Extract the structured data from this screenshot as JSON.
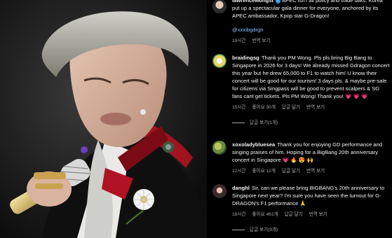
{
  "comments": [
    {
      "username": "lawrencewongst",
      "verified": true,
      "text": "APEC isn't all policy and trade talks. Korea put up a spectacular gala dinner for everyone, anchored by its APEC ambassador, Kpop star G-Dragon!",
      "mention": "@xxxibgdrgn",
      "time": "19시간",
      "translate": "번역 보기"
    },
    {
      "username": "braidingsg",
      "text": "Thank you PM Wong. Pls pls bring Big Bang to Singapore in 2026 for 3 days! We already missed Gdragon concert this year but he drew 65,000 to F1 to watch him! U know their concert will be good for our tourism! 3 days pls. & maybe pre-sale for citizens via Singpass will be good to prevent scalpers & SG fans cant get tickets. Pls PM Wong! Thank you!",
      "emojis": "💗 💗 💗",
      "time": "15시간",
      "likes": "좋아요 30개",
      "reply": "답글 달기",
      "translate": "번역 보기",
      "replies_label": "답글 보기(1개)"
    },
    {
      "username": "xoxoladybluesea",
      "text": "Thank you for enjoying GD performance and singing praises of him. Hoping for a BigBang 20th anniversary concert in Singapore",
      "emojis": "💗 🔥 😍 🙌",
      "time": "12시간",
      "likes": "좋아요 12개",
      "reply": "답글 달기",
      "translate": "번역 보기"
    },
    {
      "username": "danghl",
      "text": "Sir, can we please bring BIGBANG's 20th anniversary to Singapore next year? I'm sure you have seen the turnout for G-DRAGON's F1 performance",
      "emojis": "🙏",
      "time": "18시간",
      "likes": "좋아요 461개",
      "reply": "답글 달기",
      "translate": "번역 보기",
      "replies_label": "답글 보기(9개)"
    }
  ],
  "colors": {
    "background": "#000000",
    "text": "#f5f5f5",
    "meta": "#a8a8a8",
    "verified": "#3897f0",
    "mention": "#8cc3ff"
  }
}
